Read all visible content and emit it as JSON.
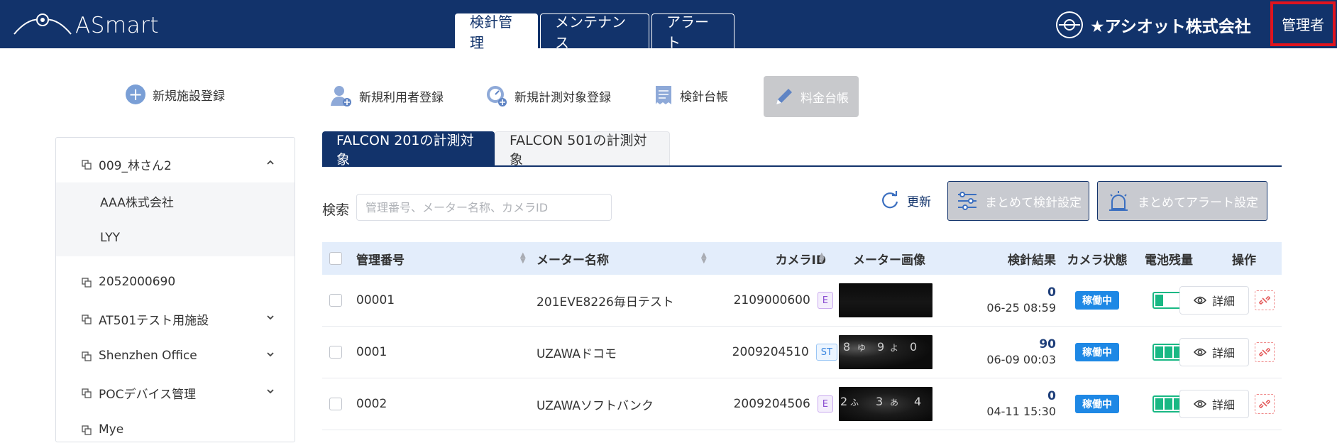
{
  "app": {
    "logo_text": "ASmart",
    "company_name": "★アシオット株式会社",
    "admin_label": "管理者"
  },
  "nav": {
    "tabs": [
      {
        "label": "検針管理",
        "active": true
      },
      {
        "label": "メンテナンス",
        "active": false
      },
      {
        "label": "アラート",
        "active": false
      }
    ]
  },
  "toolbar": {
    "new_facility": "新規施設登録",
    "new_user": "新規利用者登録",
    "new_target": "新規計測対象登録",
    "reading_ledger": "検針台帳",
    "fee_ledger": "料金台帳"
  },
  "sidebar": {
    "items": [
      {
        "label": "009_林さん2",
        "expanded": true,
        "children": [
          "AAA株式会社",
          "LYY"
        ]
      },
      {
        "label": "2052000690",
        "expanded": false
      },
      {
        "label": "AT501テスト用施設",
        "expanded": false
      },
      {
        "label": "Shenzhen Office",
        "expanded": false
      },
      {
        "label": "POCデバイス管理",
        "expanded": false
      },
      {
        "label": "Mye",
        "expanded": false
      }
    ]
  },
  "falcon_tabs": [
    {
      "label": "FALCON 201の計測対象",
      "active": true
    },
    {
      "label": "FALCON 501の計測対象",
      "active": false
    }
  ],
  "search": {
    "label": "検索",
    "placeholder": "管理番号、メーター名称、カメラID",
    "value": ""
  },
  "actions": {
    "refresh": "更新",
    "bulk_reading": "まとめて検針設定",
    "bulk_alert": "まとめてアラート設定"
  },
  "table": {
    "headers": {
      "id": "管理番号",
      "meter_name": "メーター名称",
      "camera_id": "カメラID",
      "meter_image": "メーター画像",
      "result": "検針結果",
      "camera_status": "カメラ状態",
      "battery": "電池残量",
      "operation": "操作"
    },
    "detail_label": "詳細",
    "rows": [
      {
        "id": "00001",
        "meter_name": "201EVE8226毎日テスト",
        "camera_id": "2109000600",
        "type": "E",
        "result_value": "0",
        "result_time": "06-25 08:59",
        "status": "稼働中",
        "battery_level": 0.25
      },
      {
        "id": "0001",
        "meter_name": "UZAWAドコモ",
        "camera_id": "2009204510",
        "type": "ST",
        "result_value": "90",
        "result_time": "06-09 00:03",
        "status": "稼働中",
        "battery_level": 1.0
      },
      {
        "id": "0002",
        "meter_name": "UZAWAソフトバンク",
        "camera_id": "2009204506",
        "type": "E",
        "result_value": "0",
        "result_time": "04-11 15:30",
        "status": "稼働中",
        "battery_level": 1.0
      }
    ]
  },
  "colors": {
    "header_bg": "#12336b",
    "accent_blue": "#1e88e5",
    "battery_green": "#19b884",
    "highlight_red": "#e0141e"
  }
}
